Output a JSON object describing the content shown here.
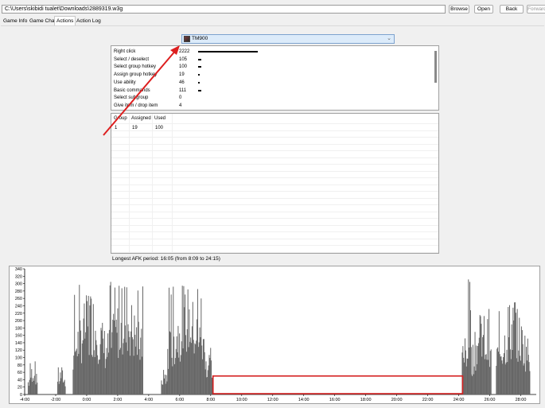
{
  "toolbar": {
    "path": "C:\\Users\\skibidi tualet\\Downloads\\2889319.w3g",
    "browse_label": "Browse",
    "open_label": "Open",
    "back_label": "Back",
    "forward_label": "Forward"
  },
  "tabs": [
    {
      "label": "Game Info"
    },
    {
      "label": "Game Chat"
    },
    {
      "label": "Actions",
      "active": true
    },
    {
      "label": "Action Log"
    }
  ],
  "player": {
    "name": "TM900",
    "icon": "hero-portrait-icon"
  },
  "actions": [
    {
      "name": "Right click",
      "value": "2222",
      "fraction": 1.0
    },
    {
      "name": "Select / deselect",
      "value": "105",
      "fraction": 0.05
    },
    {
      "name": "Select group hotkey",
      "value": "100",
      "fraction": 0.05
    },
    {
      "name": "Assign group hotkey",
      "value": "19",
      "fraction": 0.01
    },
    {
      "name": "Use ability",
      "value": "46",
      "fraction": 0.02
    },
    {
      "name": "Basic commands",
      "value": "111",
      "fraction": 0.05
    },
    {
      "name": "Select subgroup",
      "value": "0",
      "fraction": 0.0
    },
    {
      "name": "Give item / drop item",
      "value": "4",
      "fraction": 0.0
    }
  ],
  "groups": {
    "headers": [
      "Group",
      "Assigned",
      "Used"
    ],
    "rows": [
      [
        "1",
        "19",
        "100"
      ]
    ]
  },
  "afk_text": "Longest AFK period: 16:05 (from 8:09 to 24:15)",
  "annotation": {
    "color": "#dd1f1f"
  },
  "chart_data": {
    "type": "bar",
    "ylim": [
      0,
      340
    ],
    "yticks": [
      0,
      20,
      40,
      60,
      80,
      100,
      120,
      140,
      160,
      180,
      200,
      220,
      240,
      260,
      280,
      300,
      320,
      340
    ],
    "xlim": [
      -4,
      29
    ],
    "xticks": [
      "-4:00",
      "-2:00",
      "0:00",
      "2:00",
      "4:00",
      "6:00",
      "8:00",
      "10:00",
      "12:00",
      "14:00",
      "16:00",
      "18:00",
      "20:00",
      "22:00",
      "24:00",
      "26:00",
      "28:00"
    ],
    "bar_color": "#666666",
    "afk_highlight": {
      "from": 8.15,
      "to": 24.25,
      "ymax": 50,
      "color": "#d42020"
    },
    "clusters": [
      {
        "from": -3.8,
        "to": -3.2,
        "peak": 90
      },
      {
        "from": -1.9,
        "to": -1.4,
        "peak": 80
      },
      {
        "from": -0.9,
        "to": 1.3,
        "peak": 300
      },
      {
        "from": 1.3,
        "to": 3.6,
        "peak": 310
      },
      {
        "from": 4.8,
        "to": 5.2,
        "peak": 80
      },
      {
        "from": 5.2,
        "to": 7.7,
        "peak": 300
      },
      {
        "from": 7.7,
        "to": 8.1,
        "peak": 130
      },
      {
        "from": 24.2,
        "to": 24.6,
        "peak": 220
      },
      {
        "from": 24.6,
        "to": 24.8,
        "peak": 330
      },
      {
        "from": 24.8,
        "to": 26.1,
        "peak": 240
      },
      {
        "from": 26.4,
        "to": 28.6,
        "peak": 260
      }
    ]
  }
}
